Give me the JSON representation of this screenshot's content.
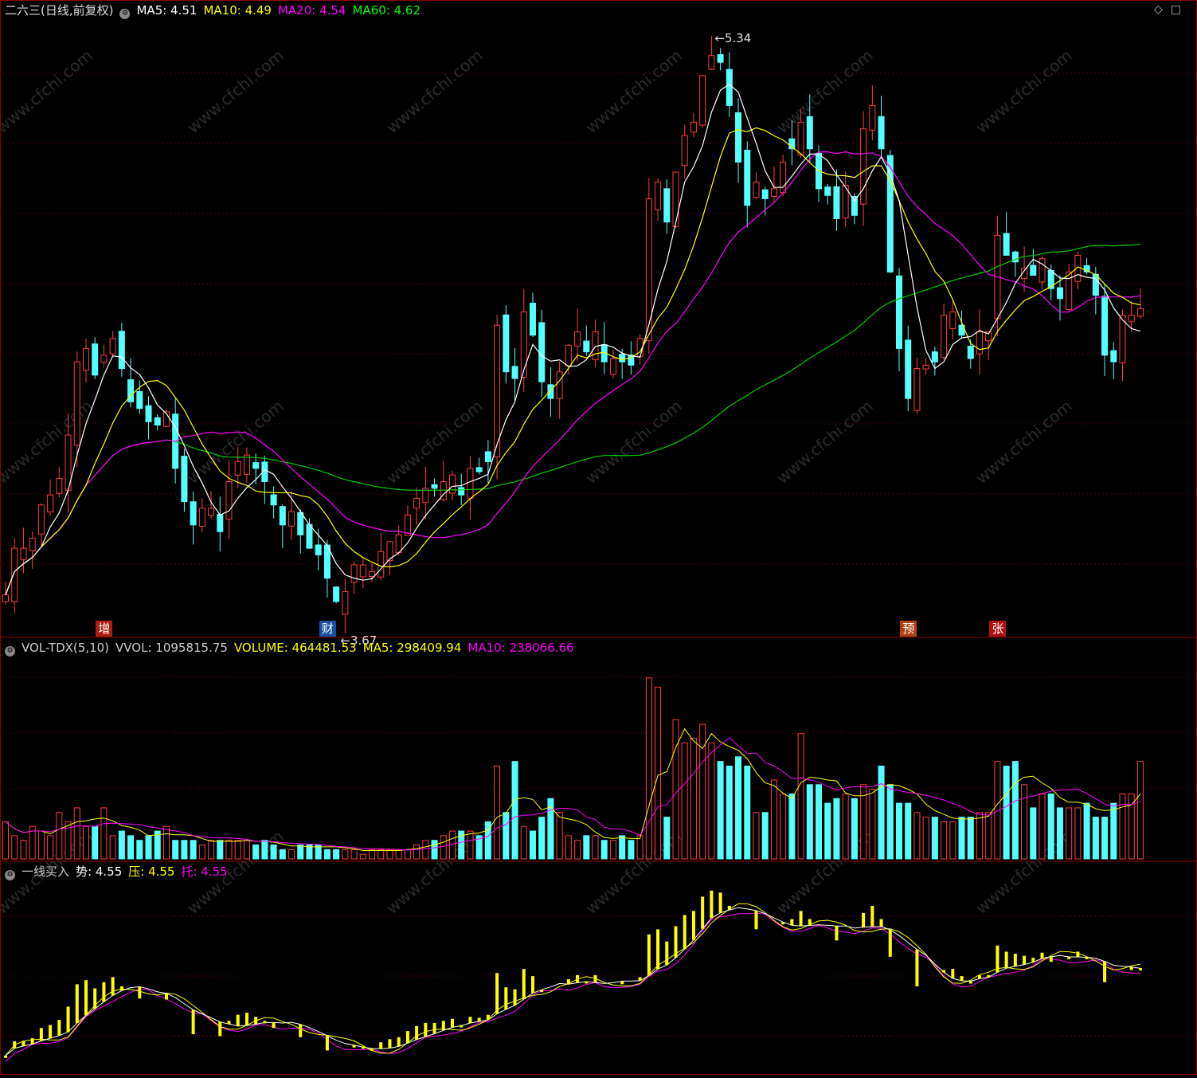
{
  "title": "二六三(日线,前复权)",
  "main_header": [
    {
      "label": "MA5: 4.51",
      "color": "#ffffff"
    },
    {
      "label": "MA10: 4.49",
      "color": "#ffff00"
    },
    {
      "label": "MA20: 4.54",
      "color": "#ff00ff"
    },
    {
      "label": "MA60: 4.62",
      "color": "#00ff00"
    }
  ],
  "vol_header": [
    {
      "label": "VOL-TDX(5,10)",
      "color": "#cccccc"
    },
    {
      "label": "VVOL: 1095815.75",
      "color": "#cccccc"
    },
    {
      "label": "VOLUME: 464481.53",
      "color": "#ffff00"
    },
    {
      "label": "MA5: 298409.94",
      "color": "#ffff00"
    },
    {
      "label": "MA10: 238066.66",
      "color": "#ff00ff"
    }
  ],
  "ind_header": [
    {
      "label": "一线买入",
      "color": "#cccccc"
    },
    {
      "label": "势: 4.55",
      "color": "#ffffff"
    },
    {
      "label": "压: 4.55",
      "color": "#ffff00"
    },
    {
      "label": "托: 4.55",
      "color": "#ff00ff"
    }
  ],
  "markers": [
    {
      "label": "增",
      "bar": 11,
      "bg": "#b02010"
    },
    {
      "label": "财",
      "bar": 36,
      "bg": "#1a4fa8"
    },
    {
      "label": "预",
      "bar": 101,
      "bg": "#b04010"
    },
    {
      "label": "张",
      "bar": 111,
      "bg": "#b01010"
    }
  ],
  "annotations": {
    "high": "5.34",
    "low": "3.67"
  },
  "watermark": "www.cfchi.com",
  "colors": {
    "up": "#ff3c3c",
    "down": "#54ffff",
    "ma5": "#ffffff",
    "ma10": "#ffff00",
    "ma20": "#ff00ff",
    "ma60": "#00cc00",
    "grid": "#8b0000"
  },
  "chart_data": {
    "type": "candlestick",
    "price_range": [
      3.6,
      5.4
    ],
    "close": [
      3.68,
      3.82,
      3.82,
      3.85,
      3.95,
      3.98,
      4.03,
      4.16,
      4.38,
      4.42,
      4.34,
      4.4,
      4.45,
      4.36,
      4.26,
      4.24,
      4.2,
      4.19,
      4.23,
      4.06,
      3.96,
      3.89,
      3.94,
      3.94,
      3.87,
      4.02,
      4.08,
      4.1,
      4.06,
      4.02,
      3.95,
      3.89,
      3.93,
      3.86,
      3.82,
      3.8,
      3.73,
      3.66,
      3.69,
      3.77,
      3.77,
      3.75,
      3.81,
      3.84,
      3.86,
      3.92,
      3.97,
      4.0,
      4.0,
      4.02,
      4.04,
      3.98,
      4.06,
      4.05,
      4.08,
      4.49,
      4.35,
      4.33,
      4.53,
      4.46,
      4.32,
      4.27,
      4.35,
      4.43,
      4.47,
      4.41,
      4.47,
      4.38,
      4.39,
      4.38,
      4.37,
      4.45,
      4.87,
      4.92,
      4.8,
      4.95,
      5.06,
      5.1,
      5.24,
      5.3,
      5.28,
      5.15,
      4.98,
      4.85,
      4.92,
      4.87,
      4.9,
      4.98,
      5.02,
      5.1,
      5.02,
      4.9,
      4.88,
      4.81,
      4.91,
      4.82,
      5.08,
      5.15,
      5.02,
      4.65,
      4.42,
      4.27,
      4.36,
      4.37,
      4.38,
      4.52,
      4.53,
      4.46,
      4.39,
      4.47,
      4.47,
      4.76,
      4.7,
      4.68,
      4.66,
      4.64,
      4.69,
      4.6,
      4.57,
      4.65,
      4.7,
      4.65,
      4.58,
      4.4,
      4.38,
      4.52,
      4.52,
      4.54
    ],
    "ma5_last": 4.51,
    "ma10_last": 4.49,
    "ma20_last": 4.54,
    "ma60_last": 4.62,
    "volume": [
      8,
      5,
      4,
      7,
      6,
      5,
      10,
      8,
      11,
      7,
      7,
      11,
      5,
      6,
      5,
      4,
      5,
      6,
      7,
      4,
      4,
      4,
      3,
      4,
      4,
      4,
      4,
      4,
      3,
      4,
      3,
      2,
      2,
      3,
      3,
      3,
      2,
      2,
      2,
      2,
      1,
      2,
      2,
      2,
      2,
      2,
      3,
      4,
      4,
      5,
      6,
      6,
      6,
      5,
      8,
      20,
      10,
      21,
      7,
      6,
      9,
      13,
      10,
      5,
      4,
      5,
      5,
      4,
      4,
      5,
      4,
      5,
      39,
      37,
      9,
      30,
      25,
      26,
      29,
      25,
      21,
      20,
      22,
      20,
      10,
      10,
      17,
      14,
      14,
      27,
      16,
      16,
      12,
      13,
      14,
      13,
      16,
      15,
      20,
      16,
      12,
      12,
      10,
      9,
      9,
      8,
      8,
      9,
      9,
      10,
      10,
      21,
      20,
      21,
      16,
      11,
      14,
      14,
      11,
      11,
      11,
      12,
      9,
      9,
      12,
      14,
      14,
      21
    ],
    "volume_ma5_last": 298409.94,
    "volume_ma10_last": 238066.66,
    "volume_last": 464481.53,
    "indicator": {
      "shi": 4.55,
      "ya": 4.55,
      "tuo": 4.55
    }
  }
}
